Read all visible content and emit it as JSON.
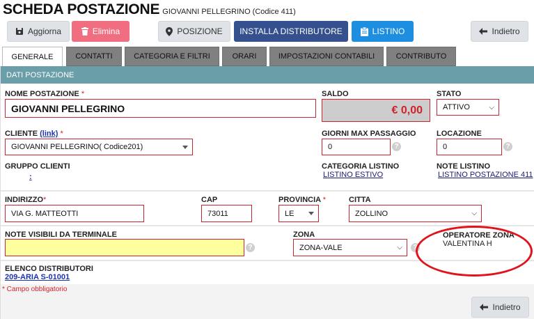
{
  "header": {
    "title": "SCHEDA POSTAZIONE",
    "subtitle": "GIOVANNI PELLEGRINO (Codice 411)"
  },
  "toolbar": {
    "save_label": "Aggiorna",
    "delete_label": "Elimina",
    "position_label": "POSIZIONE",
    "install_label": "INSTALLA DISTRIBUTORE",
    "list_label": "LISTINO",
    "back_label": "Indietro"
  },
  "tabs": [
    {
      "label": "GENERALE",
      "active": true
    },
    {
      "label": "CONTATTI"
    },
    {
      "label": "CATEGORIA E FILTRI"
    },
    {
      "label": "ORARI"
    },
    {
      "label": "IMPOSTAZIONI CONTABILI"
    },
    {
      "label": "CONTRIBUTO"
    }
  ],
  "panel": {
    "title": "DATI POSTAZIONE"
  },
  "form": {
    "nome_label": "NOME POSTAZIONE",
    "nome_value": "GIOVANNI PELLEGRINO",
    "saldo_label": "SALDO",
    "saldo_value": "€ 0,00",
    "stato_label": "STATO",
    "stato_value": "ATTIVO",
    "cliente_label": "CLIENTE",
    "cliente_link": "(link)",
    "cliente_value": "GIOVANNI PELLEGRINO( Codice201)",
    "giorni_label": "GIORNI MAX PASSAGGIO",
    "giorni_value": "0",
    "locazione_label": "LOCAZIONE",
    "locazione_value": "0",
    "gruppo_label": "GRUPPO CLIENTI",
    "gruppo_value": ":",
    "categoria_label": "CATEGORIA LISTINO",
    "categoria_value": "LISTINO ESTIVO",
    "note_listino_label": "NOTE LISTINO",
    "note_listino_value": "LISTINO POSTAZIONE 411",
    "indirizzo_label": "INDIRIZZO",
    "indirizzo_value": "VIA G. MATTEOTTI",
    "cap_label": "CAP",
    "cap_value": "73011",
    "provincia_label": "PROVINCIA",
    "provincia_value": "LE",
    "citta_label": "CITTA",
    "citta_value": "ZOLLINO",
    "note_term_label": "NOTE VISIBILI DA TERMINALE",
    "note_term_value": "",
    "zona_label": "ZONA",
    "zona_value": "ZONA-VALE",
    "operatore_label": "OPERATORE ZONA",
    "operatore_value": "VALENTINA H",
    "distributori_label": "ELENCO DISTRIBUTORI",
    "distributori_value": "209-ARIA S-01001",
    "required_note": "* Campo obbligatorio",
    "required_mark": "*"
  },
  "footer": {
    "back_label": "Indietro"
  },
  "colors": {
    "accent_navy": "#34508e",
    "accent_blue": "#1e8ee0",
    "delete_pink": "#f06e80",
    "section_header": "#6a9ea8",
    "error_red": "#d3222b",
    "annotation_circle": "#e0121a"
  }
}
